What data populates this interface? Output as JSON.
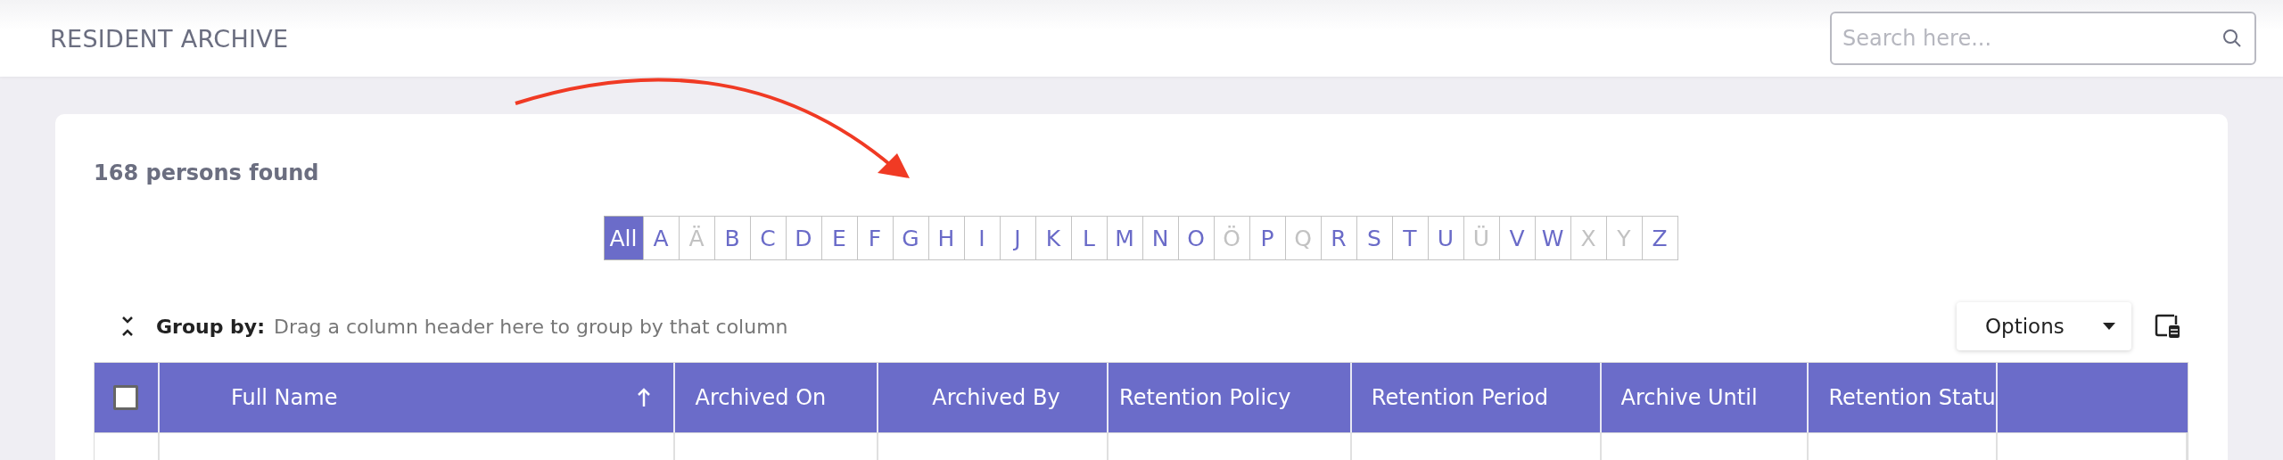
{
  "header": {
    "title": "RESIDENT ARCHIVE",
    "search": {
      "placeholder": "Search here..."
    }
  },
  "results": {
    "count_text": "168 persons found"
  },
  "alphabet": [
    {
      "label": "All",
      "selected": true,
      "disabled": false
    },
    {
      "label": "A",
      "selected": false,
      "disabled": false
    },
    {
      "label": "Ä",
      "selected": false,
      "disabled": true
    },
    {
      "label": "B",
      "selected": false,
      "disabled": false
    },
    {
      "label": "C",
      "selected": false,
      "disabled": false
    },
    {
      "label": "D",
      "selected": false,
      "disabled": false
    },
    {
      "label": "E",
      "selected": false,
      "disabled": false
    },
    {
      "label": "F",
      "selected": false,
      "disabled": false
    },
    {
      "label": "G",
      "selected": false,
      "disabled": false
    },
    {
      "label": "H",
      "selected": false,
      "disabled": false
    },
    {
      "label": "I",
      "selected": false,
      "disabled": false
    },
    {
      "label": "J",
      "selected": false,
      "disabled": false
    },
    {
      "label": "K",
      "selected": false,
      "disabled": false
    },
    {
      "label": "L",
      "selected": false,
      "disabled": false
    },
    {
      "label": "M",
      "selected": false,
      "disabled": false
    },
    {
      "label": "N",
      "selected": false,
      "disabled": false
    },
    {
      "label": "O",
      "selected": false,
      "disabled": false
    },
    {
      "label": "Ö",
      "selected": false,
      "disabled": true
    },
    {
      "label": "P",
      "selected": false,
      "disabled": false
    },
    {
      "label": "Q",
      "selected": false,
      "disabled": true
    },
    {
      "label": "R",
      "selected": false,
      "disabled": false
    },
    {
      "label": "S",
      "selected": false,
      "disabled": false
    },
    {
      "label": "T",
      "selected": false,
      "disabled": false
    },
    {
      "label": "U",
      "selected": false,
      "disabled": false
    },
    {
      "label": "Ü",
      "selected": false,
      "disabled": true
    },
    {
      "label": "V",
      "selected": false,
      "disabled": false
    },
    {
      "label": "W",
      "selected": false,
      "disabled": false
    },
    {
      "label": "X",
      "selected": false,
      "disabled": true
    },
    {
      "label": "Y",
      "selected": false,
      "disabled": true
    },
    {
      "label": "Z",
      "selected": false,
      "disabled": false
    }
  ],
  "group_by": {
    "label": "Group by:",
    "hint": "Drag a column header here to group by that column"
  },
  "options_button": {
    "label": "Options"
  },
  "table": {
    "select_all": {
      "checked": false
    },
    "columns": [
      {
        "label": "Full Name",
        "sorted": true
      },
      {
        "label": "Archived On",
        "sorted": false
      },
      {
        "label": "Archived By",
        "sorted": false
      },
      {
        "label": "Retention Policy",
        "sorted": false
      },
      {
        "label": "Retention Period",
        "sorted": false
      },
      {
        "label": "Archive Until",
        "sorted": false
      },
      {
        "label": "Retention Statu",
        "sorted": false
      },
      {
        "sorted": false
      }
    ]
  }
}
